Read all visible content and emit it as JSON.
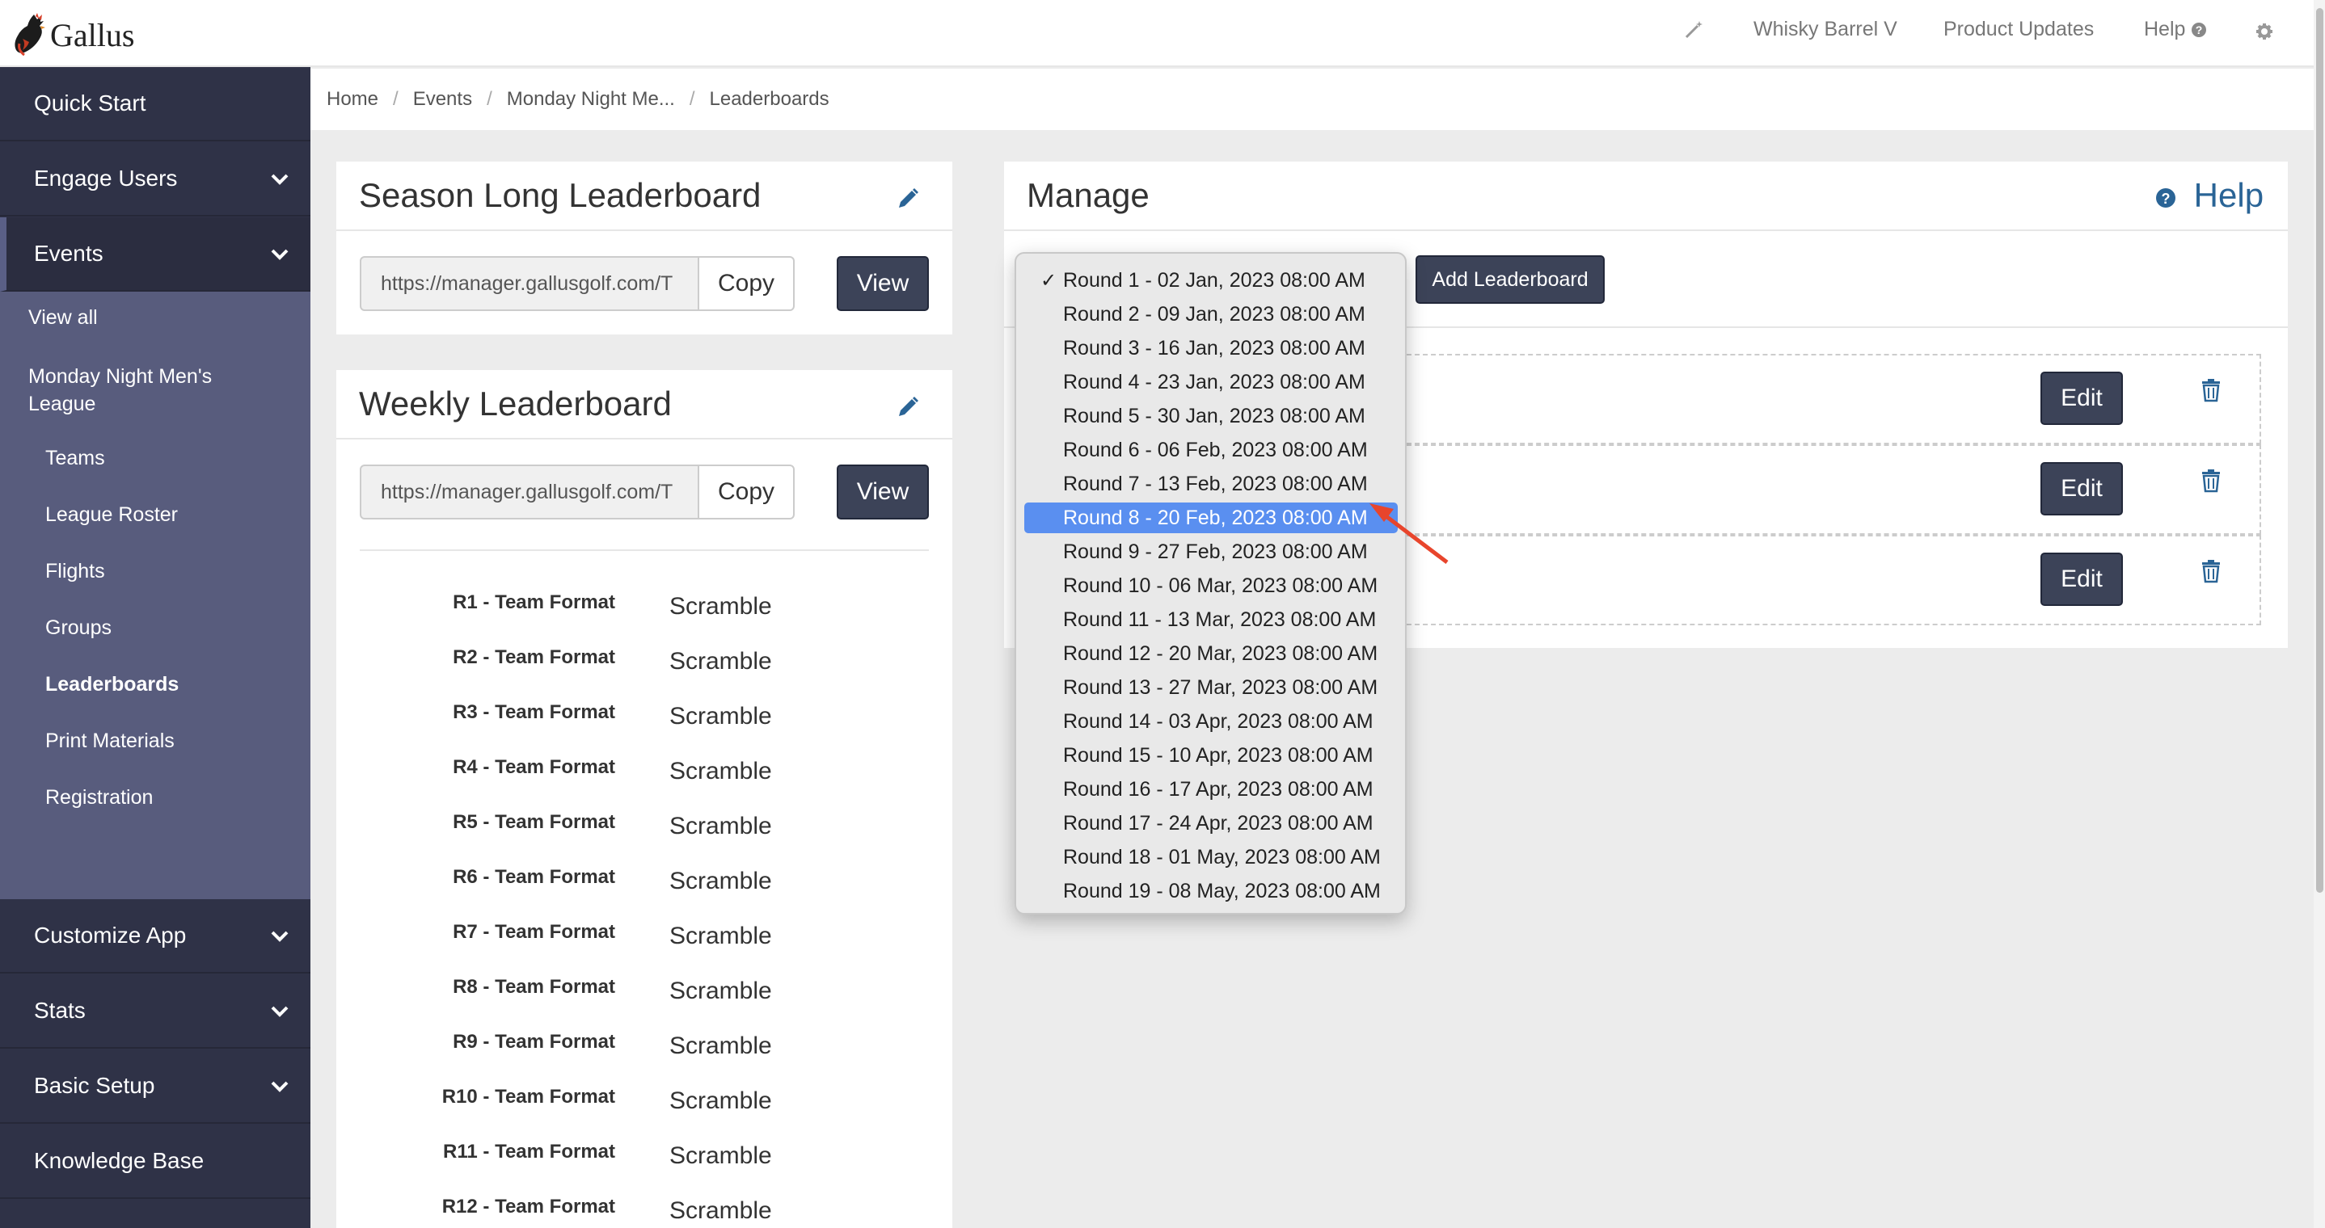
{
  "topbar": {
    "logo_text": "Gallus",
    "wand_icon": "magic-wand-icon",
    "org_name": "Whisky Barrel V",
    "product_updates": "Product Updates",
    "help": "Help",
    "help_icon": "question-circle-icon",
    "settings_icon": "gear-icon"
  },
  "sidebar": {
    "items": [
      {
        "label": "Quick Start"
      },
      {
        "label": "Engage Users",
        "chevron": true
      },
      {
        "label": "Events",
        "chevron": true,
        "active": true
      },
      {
        "label": "Customize App",
        "chevron": true
      },
      {
        "label": "Stats",
        "chevron": true
      },
      {
        "label": "Basic Setup",
        "chevron": true
      },
      {
        "label": "Knowledge Base"
      }
    ],
    "events_sub": {
      "view_all": "View all",
      "league": "Monday Night Men's League",
      "children": [
        "Teams",
        "League Roster",
        "Flights",
        "Groups",
        "Leaderboards",
        "Print Materials",
        "Registration"
      ],
      "active_child": "Leaderboards"
    }
  },
  "breadcrumb": [
    "Home",
    "Events",
    "Monday Night Me...",
    "Leaderboards"
  ],
  "season_panel": {
    "title": "Season Long Leaderboard",
    "url": "https://manager.gallusgolf.com/T",
    "copy": "Copy",
    "view": "View"
  },
  "weekly_panel": {
    "title": "Weekly Leaderboard",
    "url": "https://manager.gallusgolf.com/T",
    "copy": "Copy",
    "view": "View",
    "formats": [
      {
        "label": "R1 - Team Format",
        "value": "Scramble"
      },
      {
        "label": "R2 - Team Format",
        "value": "Scramble"
      },
      {
        "label": "R3 - Team Format",
        "value": "Scramble"
      },
      {
        "label": "R4 - Team Format",
        "value": "Scramble"
      },
      {
        "label": "R5 - Team Format",
        "value": "Scramble"
      },
      {
        "label": "R6 - Team Format",
        "value": "Scramble"
      },
      {
        "label": "R7 - Team Format",
        "value": "Scramble"
      },
      {
        "label": "R8 - Team Format",
        "value": "Scramble"
      },
      {
        "label": "R9 - Team Format",
        "value": "Scramble"
      },
      {
        "label": "R10 - Team Format",
        "value": "Scramble"
      },
      {
        "label": "R11 - Team Format",
        "value": "Scramble"
      },
      {
        "label": "R12 - Team Format",
        "value": "Scramble"
      }
    ]
  },
  "manage": {
    "title": "Manage",
    "help": "Help",
    "add_leaderboard": "Add Leaderboard",
    "edit": "Edit",
    "rows": 3
  },
  "round_select": {
    "checked": "Round 1 - 02 Jan, 2023 08:00 AM",
    "highlighted": "Round 8 - 20 Feb, 2023 08:00 AM",
    "options": [
      "Round 1 - 02 Jan, 2023 08:00 AM",
      "Round 2 - 09 Jan, 2023 08:00 AM",
      "Round 3 - 16 Jan, 2023 08:00 AM",
      "Round 4 - 23 Jan, 2023 08:00 AM",
      "Round 5 - 30 Jan, 2023 08:00 AM",
      "Round 6 - 06 Feb, 2023 08:00 AM",
      "Round 7 - 13 Feb, 2023 08:00 AM",
      "Round 8 - 20 Feb, 2023 08:00 AM",
      "Round 9 - 27 Feb, 2023 08:00 AM",
      "Round 10 - 06 Mar, 2023 08:00 AM",
      "Round 11 - 13 Mar, 2023 08:00 AM",
      "Round 12 - 20 Mar, 2023 08:00 AM",
      "Round 13 - 27 Mar, 2023 08:00 AM",
      "Round 14 - 03 Apr, 2023 08:00 AM",
      "Round 15 - 10 Apr, 2023 08:00 AM",
      "Round 16 - 17 Apr, 2023 08:00 AM",
      "Round 17 - 24 Apr, 2023 08:00 AM",
      "Round 18 - 01 May, 2023 08:00 AM",
      "Round 19 - 08 May, 2023 08:00 AM"
    ]
  },
  "colors": {
    "sidebar": "#2f3247",
    "sidebar_sub": "#585c7d",
    "button_dark": "#3c4358",
    "link_blue": "#2a6496",
    "highlight": "#5a8ff0",
    "annotation_arrow": "#e8452c"
  }
}
